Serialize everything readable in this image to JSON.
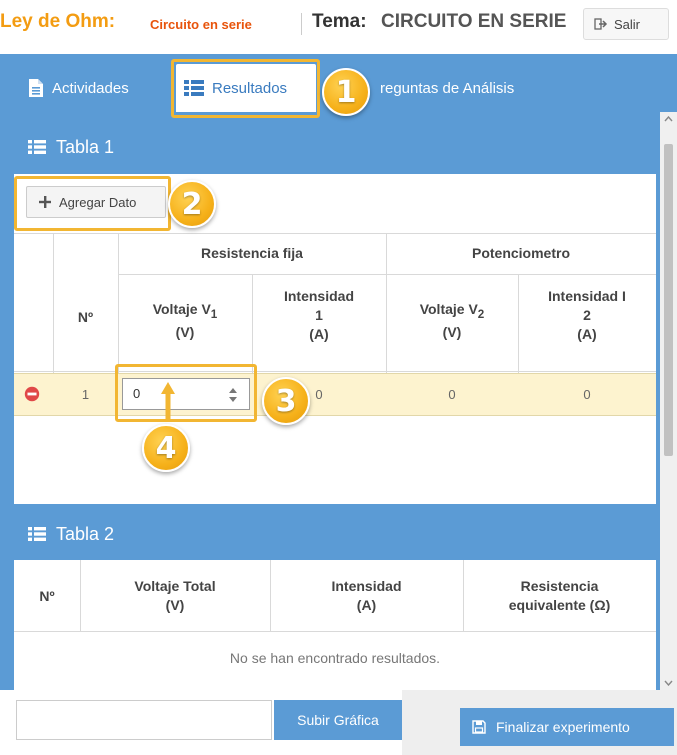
{
  "header": {
    "lab_title": "Ley de Ohm:",
    "lab_subtitle": "Circuito en serie",
    "tema_label": "Tema:",
    "tema_value": "CIRCUITO EN SERIE",
    "salir_label": "Salir"
  },
  "tabs": [
    {
      "label": "Actividades",
      "icon": "document-icon"
    },
    {
      "label": "Resultados",
      "icon": "list-icon",
      "active": true
    },
    {
      "label": "reguntas de Análisis"
    }
  ],
  "tabla1": {
    "title": "Tabla 1",
    "add_button": "Agregar Dato",
    "group_headers": [
      "Resistencia fija",
      "Potenciometro"
    ],
    "columns": {
      "num": "Nº",
      "v1_main": "Voltaje V",
      "v1_sub": "1",
      "v1_unit": "(V)",
      "i1_main": "Intensidad",
      "i1_sub": "1",
      "i1_unit": "(A)",
      "v2_main": "Voltaje V",
      "v2_sub": "2",
      "v2_unit": "(V)",
      "i2_main": "Intensidad I",
      "i2_sub": "2",
      "i2_unit": "(A)"
    },
    "row": {
      "num": "1",
      "v1": "0",
      "i1": "0",
      "v2": "0",
      "i2": "0"
    }
  },
  "tabla2": {
    "title": "Tabla 2",
    "columns": {
      "num": "Nº",
      "vt": "Voltaje Total",
      "vt_unit": "(V)",
      "int": "Intensidad",
      "int_unit": "(A)",
      "res": "Resistencia",
      "res_unit": "equivalente (Ω)"
    },
    "empty_message": "No se han encontrado resultados."
  },
  "footer": {
    "upload_label": "Subir Gráfica",
    "finish_label": "Finalizar experimento"
  },
  "callouts": [
    "1",
    "2",
    "3",
    "4"
  ],
  "colors": {
    "accent_blue": "#5b9bd5",
    "callout_gold": "#f6b11a",
    "title_orange": "#f39c12",
    "row_highlight": "#fdf3cf"
  }
}
